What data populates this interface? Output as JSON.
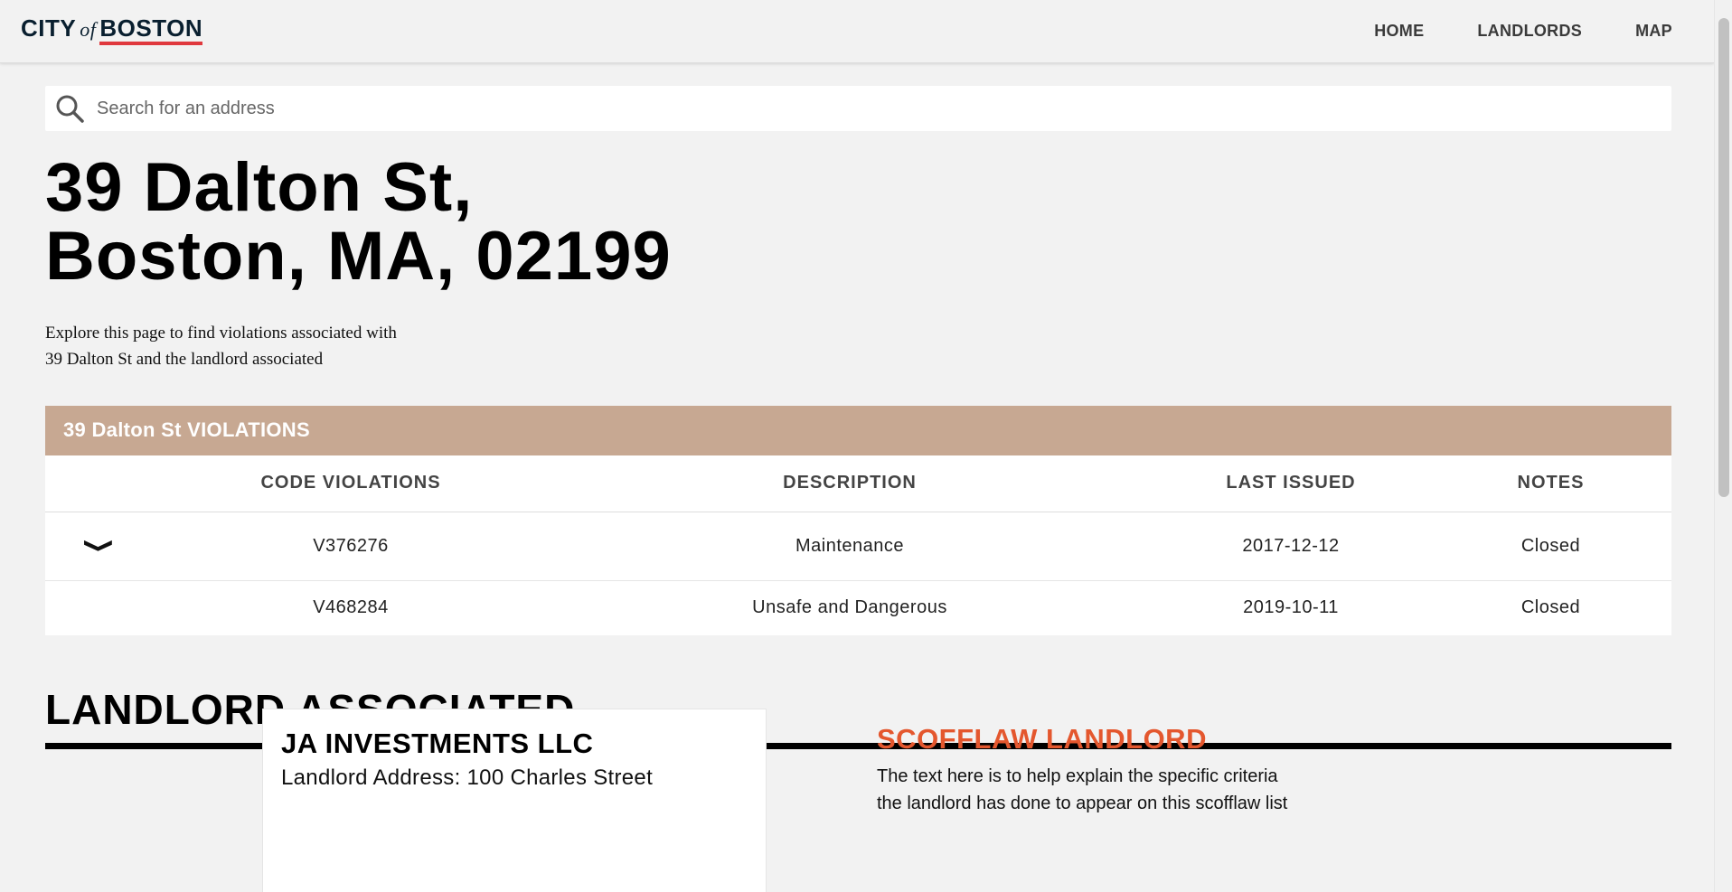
{
  "header": {
    "logo": {
      "city": "CITY",
      "of": "of",
      "boston": "BOSTON"
    },
    "nav": [
      "HOME",
      "LANDLORDS",
      "MAP"
    ]
  },
  "search": {
    "placeholder": "Search for an address",
    "value": ""
  },
  "address": {
    "line1": "39 Dalton St,",
    "line2": "Boston, MA, 02199"
  },
  "intro": {
    "line1": "Explore this page to find violations associated with",
    "line2": "39 Dalton St and the landlord associated"
  },
  "violations": {
    "title": "39 Dalton St VIOLATIONS",
    "columns": [
      "CODE VIOLATIONS",
      "DESCRIPTION",
      "LAST ISSUED",
      "NOTES"
    ],
    "rows": [
      {
        "code": "V376276",
        "description": "Maintenance",
        "last_issued": "2017-12-12",
        "notes": "Closed",
        "expand": "❯"
      },
      {
        "code": "V468284",
        "description": "Unsafe and Dangerous",
        "last_issued": "2019-10-11",
        "notes": "Closed"
      }
    ]
  },
  "landlord_section": {
    "heading": "LANDLORD ASSOCIATED",
    "name": "JA INVESTMENTS LLC",
    "address": "Landlord Address: 100 Charles Street"
  },
  "scofflaw": {
    "title": "SCOFFLAW LANDLORD",
    "line1": "The text here is to help explain the specific criteria",
    "line2": "the landlord has done to appear on this scofflaw list"
  },
  "icons": {
    "search": "search-icon",
    "expand": "chevron-down-icon"
  },
  "colors": {
    "accent_red": "#e0393e",
    "violations_header": "#c7a892",
    "scofflaw_orange": "#e4572e",
    "brand_navy": "#091f2f"
  }
}
